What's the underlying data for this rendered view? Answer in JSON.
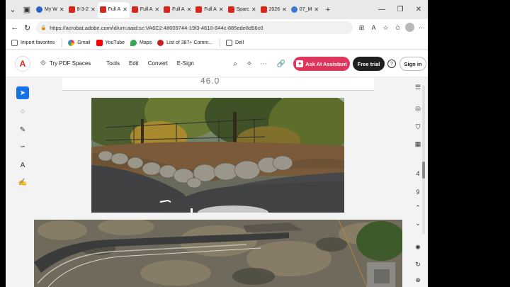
{
  "tabs": [
    {
      "label": "",
      "icon": "workspace-icon"
    },
    {
      "label": "My W",
      "icon": "blue-app-icon"
    },
    {
      "label": "8-3-2",
      "icon": "pdf-icon"
    },
    {
      "label": "Full A",
      "icon": "pdf-icon",
      "active": true
    },
    {
      "label": "Full A",
      "icon": "pdf-icon"
    },
    {
      "label": "Full A",
      "icon": "pdf-icon"
    },
    {
      "label": "Full A",
      "icon": "pdf-icon"
    },
    {
      "label": "Sparc",
      "icon": "pdf-icon"
    },
    {
      "label": "2026",
      "icon": "pdf-icon"
    },
    {
      "label": "07_M",
      "icon": "globe-icon"
    }
  ],
  "new_tab": "+",
  "address": {
    "url": "https://acrobat.adobe.com/id/urn:aaid:sc:VA6C2:48009744-19f3-4610-844c-885ede8d56c0"
  },
  "favorites": [
    {
      "label": "Import favorites",
      "icon": "import-icon"
    },
    {
      "label": "Gmail",
      "icon": "google-icon"
    },
    {
      "label": "YouTube",
      "icon": "youtube-icon"
    },
    {
      "label": "Maps",
      "icon": "maps-icon"
    },
    {
      "label": "List of 387+ Comm...",
      "icon": "list-icon"
    },
    {
      "label": "Dell",
      "icon": "folder-icon"
    }
  ],
  "acrobat": {
    "spaces_label": "Try PDF Spaces",
    "menu": [
      "Tools",
      "Edit",
      "Convert",
      "E-Sign"
    ],
    "ai_button": "Ask AI Assistant",
    "trial_button": "Free trial",
    "signin_button": "Sign in"
  },
  "document": {
    "page_number_text": "46.0"
  },
  "right_rail": {
    "page_current": "4",
    "page_total": "9"
  },
  "colors": {
    "accent": "#1473e6",
    "ai": "#e0355b",
    "pdf_red": "#d7271d"
  }
}
